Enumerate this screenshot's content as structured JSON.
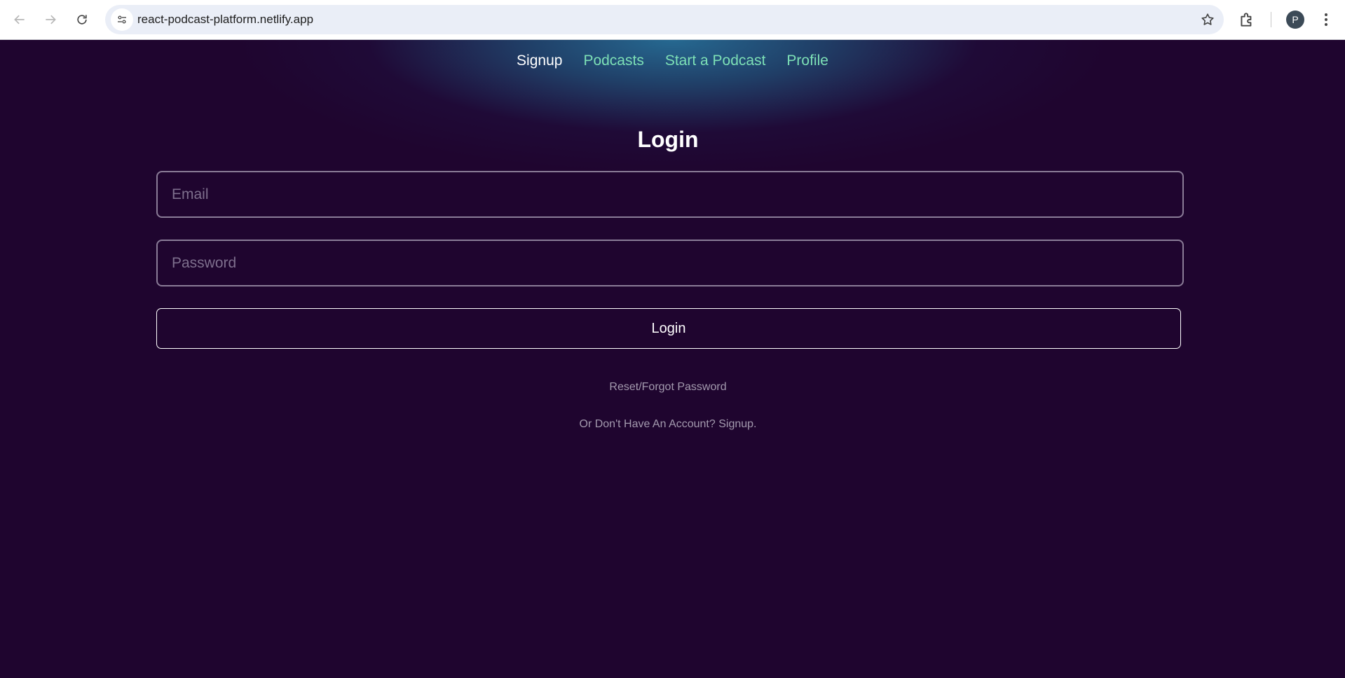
{
  "browser": {
    "url": "react-podcast-platform.netlify.app",
    "profile_initial": "P",
    "icons": {
      "back": "back-arrow-icon",
      "forward": "forward-arrow-icon",
      "reload": "reload-icon",
      "site_info": "tune-icon",
      "bookmark": "star-icon",
      "extensions": "puzzle-icon",
      "menu": "kebab-menu-icon"
    }
  },
  "nav": {
    "items": [
      {
        "label": "Signup",
        "active": true
      },
      {
        "label": "Podcasts",
        "active": false
      },
      {
        "label": "Start a Podcast",
        "active": false
      },
      {
        "label": "Profile",
        "active": false
      }
    ]
  },
  "login": {
    "title": "Login",
    "email_placeholder": "Email",
    "password_placeholder": "Password",
    "button_label": "Login",
    "reset_link": "Reset/Forgot Password",
    "signup_text": "Or Don't Have An Account? Signup."
  },
  "colors": {
    "background": "#1f052f",
    "nav_link": "#7de0b6",
    "nav_active": "#ffffff",
    "muted_text": "#a39aae"
  }
}
